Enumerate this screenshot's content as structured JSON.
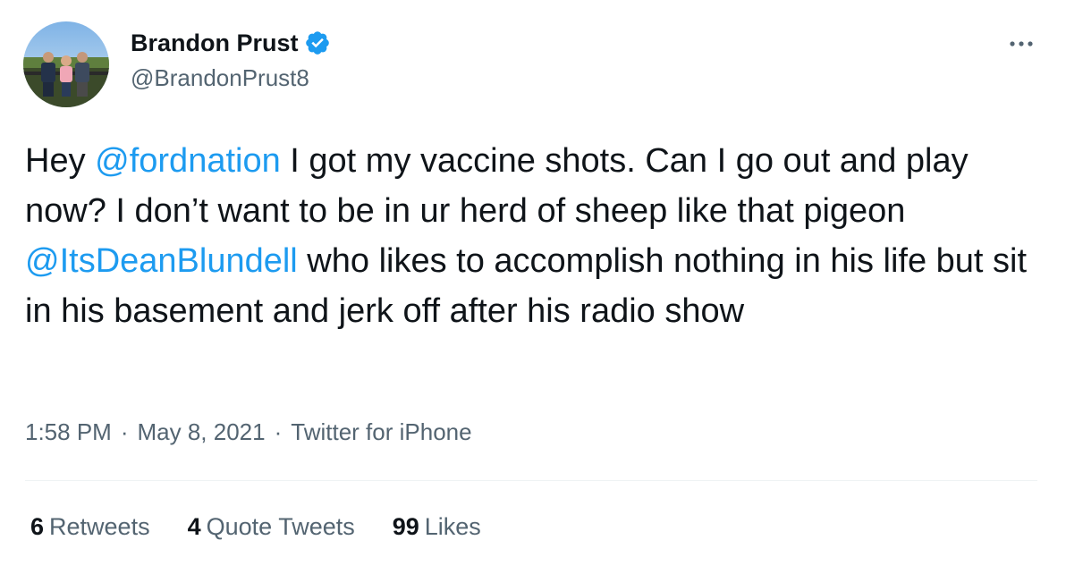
{
  "author": {
    "display_name": "Brandon Prust",
    "handle": "@BrandonPrust8",
    "verified": true
  },
  "tweet": {
    "segments": [
      {
        "type": "text",
        "text": "Hey "
      },
      {
        "type": "mention",
        "text": "@fordnation"
      },
      {
        "type": "text",
        "text": " I got my vaccine shots. Can I go out and play now? I don’t want to be in ur herd of sheep like that pigeon "
      },
      {
        "type": "mention",
        "text": "@ItsDeanBlundell"
      },
      {
        "type": "text",
        "text": " who likes to accomplish nothing in his life but sit in his basement and jerk off after his radio show"
      }
    ]
  },
  "meta": {
    "time": "1:58 PM",
    "separator": "·",
    "date": "May 8, 2021",
    "source": "Twitter for iPhone"
  },
  "stats": {
    "retweets": {
      "count": "6",
      "label": "Retweets"
    },
    "quotes": {
      "count": "4",
      "label": "Quote Tweets"
    },
    "likes": {
      "count": "99",
      "label": "Likes"
    }
  },
  "icons": {
    "verified": "verified-badge-icon",
    "more": "more-options-icon"
  },
  "colors": {
    "accent": "#1d9bf0",
    "secondary_text": "#536471",
    "primary_text": "#0f1419",
    "divider": "#eff3f4"
  }
}
